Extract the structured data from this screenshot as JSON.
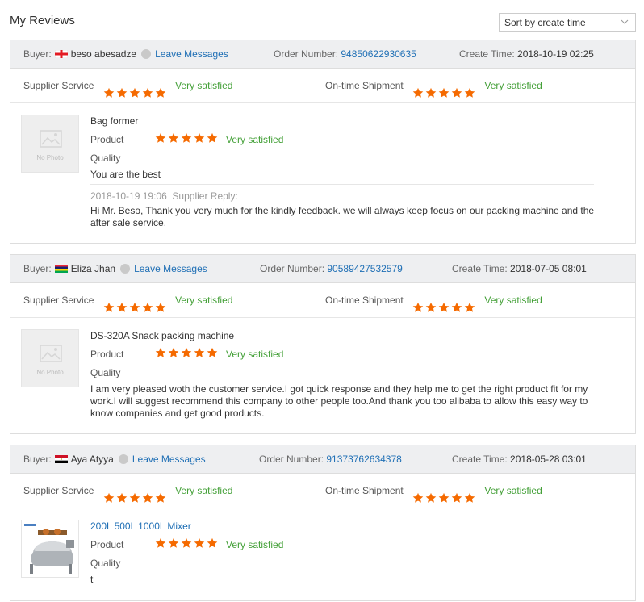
{
  "page": {
    "title": "My Reviews"
  },
  "sort": {
    "selected": "Sort by create time"
  },
  "labels": {
    "buyer": "Buyer:",
    "leave_messages": "Leave Messages",
    "order_number": "Order Number:",
    "create_time": "Create Time:",
    "supplier_service": "Supplier Service",
    "ontime_shipment": "On-time Shipment",
    "product": "Product",
    "quality": "Quality",
    "supplier_reply": "Supplier Reply:",
    "no_photo": "No Photo"
  },
  "colors": {
    "star": "#f56a00",
    "satisfied": "#44a038",
    "link": "#1f6fb5",
    "header_bg": "#eeeff1"
  },
  "reviews": [
    {
      "buyer": "beso abesadze",
      "flag": "georgia",
      "order_number": "94850622930635",
      "create_time": "2018-10-19 02:25",
      "supplier_service": {
        "stars": 5,
        "text": "Very satisfied"
      },
      "ontime_shipment": {
        "stars": 5,
        "text": "Very satisfied"
      },
      "product_name": "Bag former",
      "product_rating": {
        "stars": 5,
        "text": "Very satisfied"
      },
      "comment": "You are the best",
      "reply_time": "2018-10-19 19:06",
      "reply_text": "Hi Mr. Beso, Thank you very much for the kindly feedback. we will always keep focus on our packing machine and the after sale service."
    },
    {
      "buyer": "Eliza Jhan",
      "flag": "mauritius",
      "order_number": "90589427532579",
      "create_time": "2018-07-05 08:01",
      "supplier_service": {
        "stars": 5,
        "text": "Very satisfied"
      },
      "ontime_shipment": {
        "stars": 5,
        "text": "Very satisfied"
      },
      "product_name": "DS-320A Snack packing machine",
      "product_rating": {
        "stars": 5,
        "text": "Very satisfied"
      },
      "comment": "I am very pleased woth the customer service.I got quick response and they help me to get the right product fit for my work.I will suggest recommend this company to other people too.And thank you too alibaba to allow this easy way to know companies and get good products."
    },
    {
      "buyer": "Aya Atyya",
      "flag": "egypt",
      "order_number": "91373762634378",
      "create_time": "2018-05-28 03:01",
      "supplier_service": {
        "stars": 5,
        "text": "Very satisfied"
      },
      "ontime_shipment": {
        "stars": 5,
        "text": "Very satisfied"
      },
      "product_name": "200L 500L 1000L Mixer",
      "product_rating": {
        "stars": 5,
        "text": "Very satisfied"
      },
      "comment": "t"
    }
  ]
}
